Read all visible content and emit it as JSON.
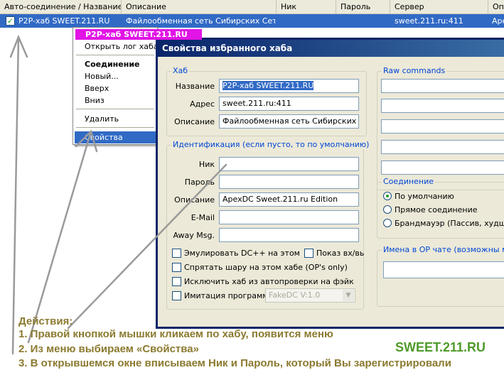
{
  "list": {
    "columns": [
      "Авто-соединение / Название",
      "Описание",
      "Ник",
      "Пароль",
      "Сервер",
      "Оп"
    ],
    "row": {
      "name": "P2P-хаб SWEET.211.RU",
      "description": "Файлообменная сеть Сибирских Сетей",
      "server": "sweet.211.ru:411",
      "extra": "Аре"
    }
  },
  "context_menu": {
    "title": "P2P-хаб SWEET.211.RU",
    "open_log": "Открыть лог хаба",
    "connect": "Соединение",
    "new": "Новый...",
    "up": "Вверх",
    "down": "Вниз",
    "delete": "Удалить",
    "properties": "Свойства"
  },
  "dialog": {
    "title": "Свойства избранного хаба",
    "hub_group": "Хаб",
    "name_label": "Название",
    "name_value": "P2P-хаб SWEET.211.RU",
    "address_label": "Адрес",
    "address_value": "sweet.211.ru:411",
    "desc_label": "Описание",
    "desc_value": "Файлообменная сеть Сибирских Сет",
    "ident_group": "Идентификация (если пусто, то по умолчанию)",
    "nick_label": "Ник",
    "nick_value": "",
    "pass_label": "Пароль",
    "pass_value": "",
    "ident_desc_label": "Описание",
    "ident_desc_value": "ApexDC Sweet.211.ru Edition",
    "email_label": "E-Mail",
    "email_value": "",
    "away_label": "Away Msg.",
    "away_value": "",
    "cb_emulate": "Эмулировать DC++ на этом хабе",
    "cb_show": "Показ вх/вых",
    "cb_hide_share": "Спрятать шару на этом хабе (OP's only)",
    "cb_exclude": "Исключить хаб из автопроверки на фэйк",
    "cb_imitate": "Имитация программы",
    "imitate_combo": "FakeDC V:1.0",
    "raw_group": "Raw commands",
    "conn_group": "Соединение",
    "radio_default": "По умолчанию",
    "radio_direct": "Прямое соединение",
    "radio_firewall": "Брандмауэр (Пассив, худший р",
    "op_group": "Имена в OP чате (возможны маски"
  },
  "instructions": {
    "heading": "Действия:",
    "step1": "1. Правой кнопкой мышки кликаем по хабу, появится меню",
    "step2": "2. Из меню выбираем «Свойства»",
    "step3": "3. В открывшемся окне вписываем Ник и Пароль, который Вы зарегистрировали"
  },
  "brand": "SWEET.211.RU",
  "colors": {
    "selection": "#316ac5",
    "menu_title": "#e214e6",
    "instruction_text": "#8b7a2f",
    "brand": "#4f9a2a"
  }
}
